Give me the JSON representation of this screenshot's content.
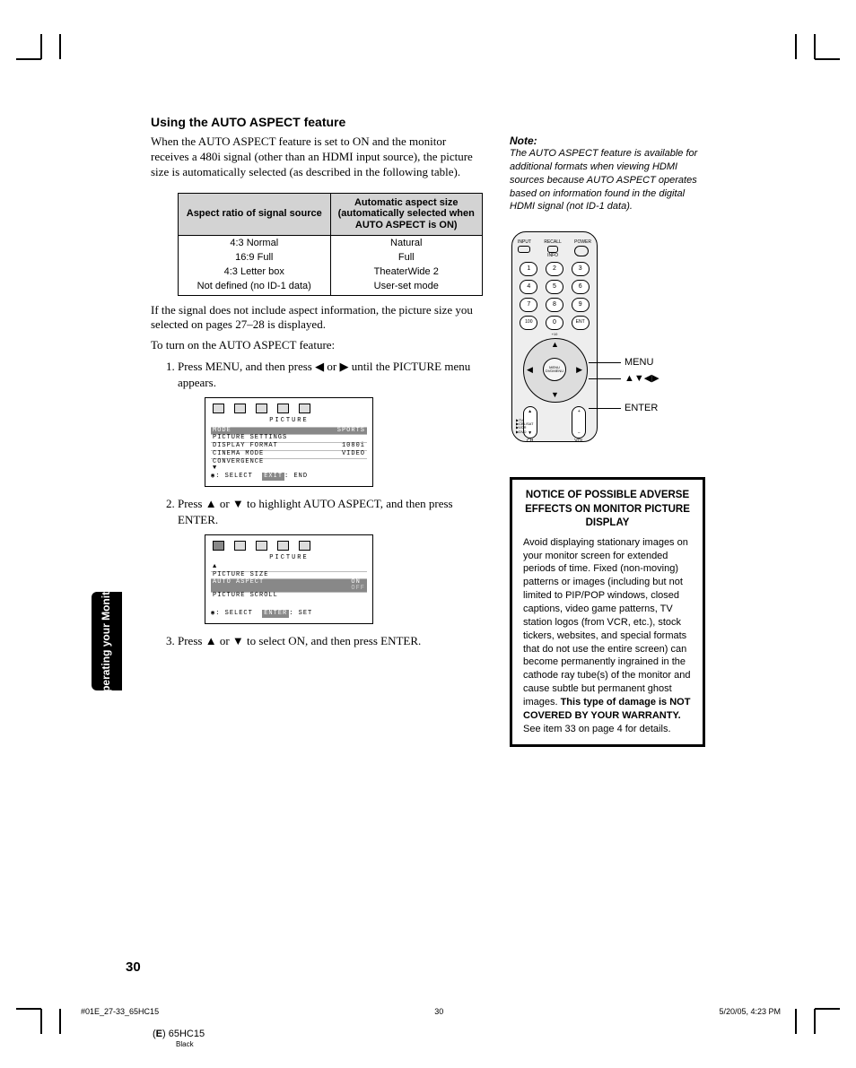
{
  "heading": "Using the AUTO ASPECT feature",
  "intro": "When the AUTO ASPECT feature is set to ON and the monitor receives a 480i signal (other than an HDMI input source), the picture size is automatically selected (as described in the following table).",
  "table": {
    "h1": "Aspect ratio of signal source",
    "h2": "Automatic aspect size (automatically selected when AUTO ASPECT is ON)",
    "rows": [
      {
        "a": "4:3 Normal",
        "b": "Natural"
      },
      {
        "a": "16:9 Full",
        "b": "Full"
      },
      {
        "a": "4:3 Letter box",
        "b": "TheaterWide 2"
      },
      {
        "a": "Not defined (no ID-1 data)",
        "b": "User-set mode"
      }
    ]
  },
  "para2": "If the signal does not include aspect information, the picture size you selected on pages 27–28 is displayed.",
  "para3": "To turn on the AUTO ASPECT feature:",
  "steps": {
    "s1a": "Press MENU, and then press ",
    "s1b": " or ",
    "s1c": " until the PICTURE menu appears.",
    "s2a": "Press ",
    "s2b": " or ",
    "s2c": " to highlight AUTO ASPECT, and then press ENTER.",
    "s3a": "Press ",
    "s3b": " or ",
    "s3c": " to select ON, and then press ENTER."
  },
  "osd1": {
    "title": "PICTURE",
    "rows": [
      {
        "l": "MODE",
        "r": "SPORTS"
      },
      {
        "l": "PICTURE SETTINGS",
        "r": ""
      },
      {
        "l": "DISPLAY FORMAT",
        "r": "1080i"
      },
      {
        "l": "CINEMA MODE",
        "r": "VIDEO"
      },
      {
        "l": "CONVERGENCE",
        "r": ""
      }
    ],
    "foot_select": ": SELECT",
    "foot_exit": "EXIT",
    "foot_end": ": END"
  },
  "osd2": {
    "title": "PICTURE",
    "rows": [
      {
        "l": "PICTURE SIZE",
        "r": ""
      },
      {
        "l": "AUTO ASPECT",
        "r": "ON",
        "r2": "OFF",
        "hi": true
      },
      {
        "l": "PICTURE SCROLL",
        "r": ""
      }
    ],
    "foot_select": ": SELECT",
    "foot_enter": "ENTER",
    "foot_set": ": SET"
  },
  "note": {
    "label": "Note:",
    "text": "The AUTO ASPECT feature is available for additional formats when viewing HDMI sources because AUTO ASPECT operates based on information found in the digital HDMI signal (not ID-1 data)."
  },
  "remote": {
    "top": {
      "input": "INPUT",
      "recall": "RECALL",
      "info": "INFO",
      "power": "POWER"
    },
    "nums": [
      "1",
      "2",
      "3",
      "4",
      "5",
      "6",
      "7",
      "8",
      "9",
      "100",
      "0",
      "ENT"
    ],
    "plus10": "+10",
    "center": "MENU DVDMENU",
    "ch": "CH",
    "vol": "VOL",
    "dev": [
      "TV",
      "CBL/SAT",
      "VCR",
      "DVD"
    ],
    "callouts": {
      "menu": "MENU",
      "arrows": "▲▼◀▶",
      "enter": "ENTER"
    }
  },
  "notice": {
    "title": "NOTICE OF POSSIBLE ADVERSE EFFECTS ON MONITOR PICTURE DISPLAY",
    "body1": "Avoid displaying stationary images on your monitor screen for extended periods of time. Fixed (non-moving) patterns or images (including but not limited to PIP/POP windows, closed captions, video game patterns, TV station logos (from VCR, etc.), stock tickers, websites, and special formats that do not use the entire screen) can become permanently ingrained in the cathode ray tube(s) of the monitor and cause subtle but permanent ghost images. ",
    "body2": "This type of damage is NOT COVERED BY YOUR WARRANTY.",
    "body3": " See item 33 on page 4 for details."
  },
  "sidetab": "Operating your\nMonitor",
  "pagenum": "30",
  "footer": {
    "left": "#01E_27-33_65HC15",
    "mid": "30",
    "right": "5/20/05, 4:23 PM"
  },
  "footer2a": "(",
  "footer2b": "E",
  "footer2c": ") 65HC15",
  "colorlabel": "Black"
}
